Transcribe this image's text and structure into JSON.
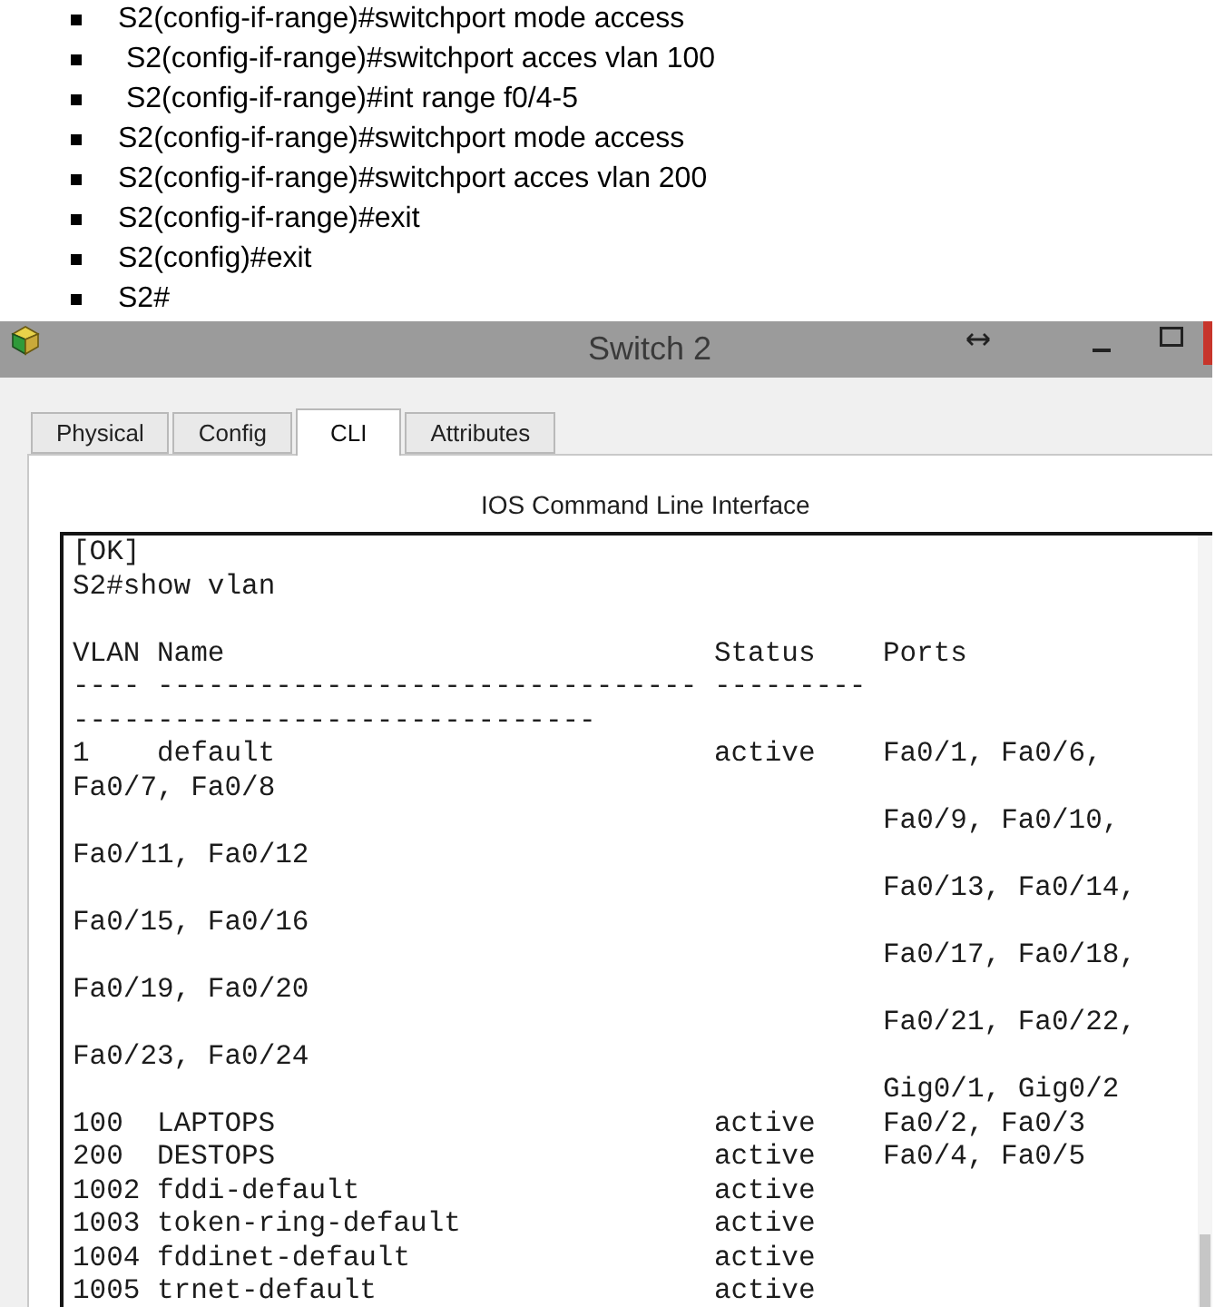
{
  "bullet_list": [
    "S2(config-if-range)#switchport mode access",
    " S2(config-if-range)#switchport acces vlan 100",
    " S2(config-if-range)#int range f0/4-5",
    "S2(config-if-range)#switchport mode access",
    "S2(config-if-range)#switchport acces vlan 200",
    "S2(config-if-range)#exit",
    "S2(config)#exit",
    "S2#"
  ],
  "window": {
    "title": "Switch 2",
    "tabs": [
      {
        "label": "Physical",
        "selected": false
      },
      {
        "label": "Config",
        "selected": false
      },
      {
        "label": "CLI",
        "selected": true
      },
      {
        "label": "Attributes",
        "selected": false
      }
    ],
    "panel_heading": "IOS Command Line Interface",
    "terminal": {
      "lines": [
        {
          "kind": "text",
          "text": "[OK]"
        },
        {
          "kind": "text",
          "text": "S2#show vlan"
        },
        {
          "kind": "blank"
        },
        {
          "kind": "header",
          "cells": [
            "VLAN",
            "Name",
            "Status",
            "Ports"
          ]
        },
        {
          "kind": "rule",
          "cells": [
            "----",
            "--------------------------------",
            "---------"
          ]
        },
        {
          "kind": "rule",
          "cells": [
            "-------------------------------"
          ]
        },
        {
          "kind": "row",
          "cells": [
            "1",
            "default",
            "active",
            "Fa0/1, Fa0/6,"
          ]
        },
        {
          "kind": "text",
          "text": "Fa0/7, Fa0/8"
        },
        {
          "kind": "ports",
          "text": "Fa0/9, Fa0/10,"
        },
        {
          "kind": "text",
          "text": "Fa0/11, Fa0/12"
        },
        {
          "kind": "ports",
          "text": "Fa0/13, Fa0/14,"
        },
        {
          "kind": "text",
          "text": "Fa0/15, Fa0/16"
        },
        {
          "kind": "ports",
          "text": "Fa0/17, Fa0/18,"
        },
        {
          "kind": "text",
          "text": "Fa0/19, Fa0/20"
        },
        {
          "kind": "ports",
          "text": "Fa0/21, Fa0/22,"
        },
        {
          "kind": "text",
          "text": "Fa0/23, Fa0/24"
        },
        {
          "kind": "ports",
          "text": "Gig0/1, Gig0/2"
        },
        {
          "kind": "row",
          "cells": [
            "100",
            "LAPTOPS",
            "active",
            "Fa0/2, Fa0/3"
          ]
        },
        {
          "kind": "row",
          "cells": [
            "200",
            "DESTOPS",
            "active",
            "Fa0/4, Fa0/5"
          ]
        },
        {
          "kind": "row",
          "cells": [
            "1002",
            "fddi-default",
            "active"
          ]
        },
        {
          "kind": "row",
          "cells": [
            "1003",
            "token-ring-default",
            "active"
          ]
        },
        {
          "kind": "row",
          "cells": [
            "1004",
            "fddinet-default",
            "active"
          ]
        },
        {
          "kind": "row",
          "cells": [
            "1005",
            "trnet-default",
            "active"
          ]
        }
      ]
    }
  }
}
